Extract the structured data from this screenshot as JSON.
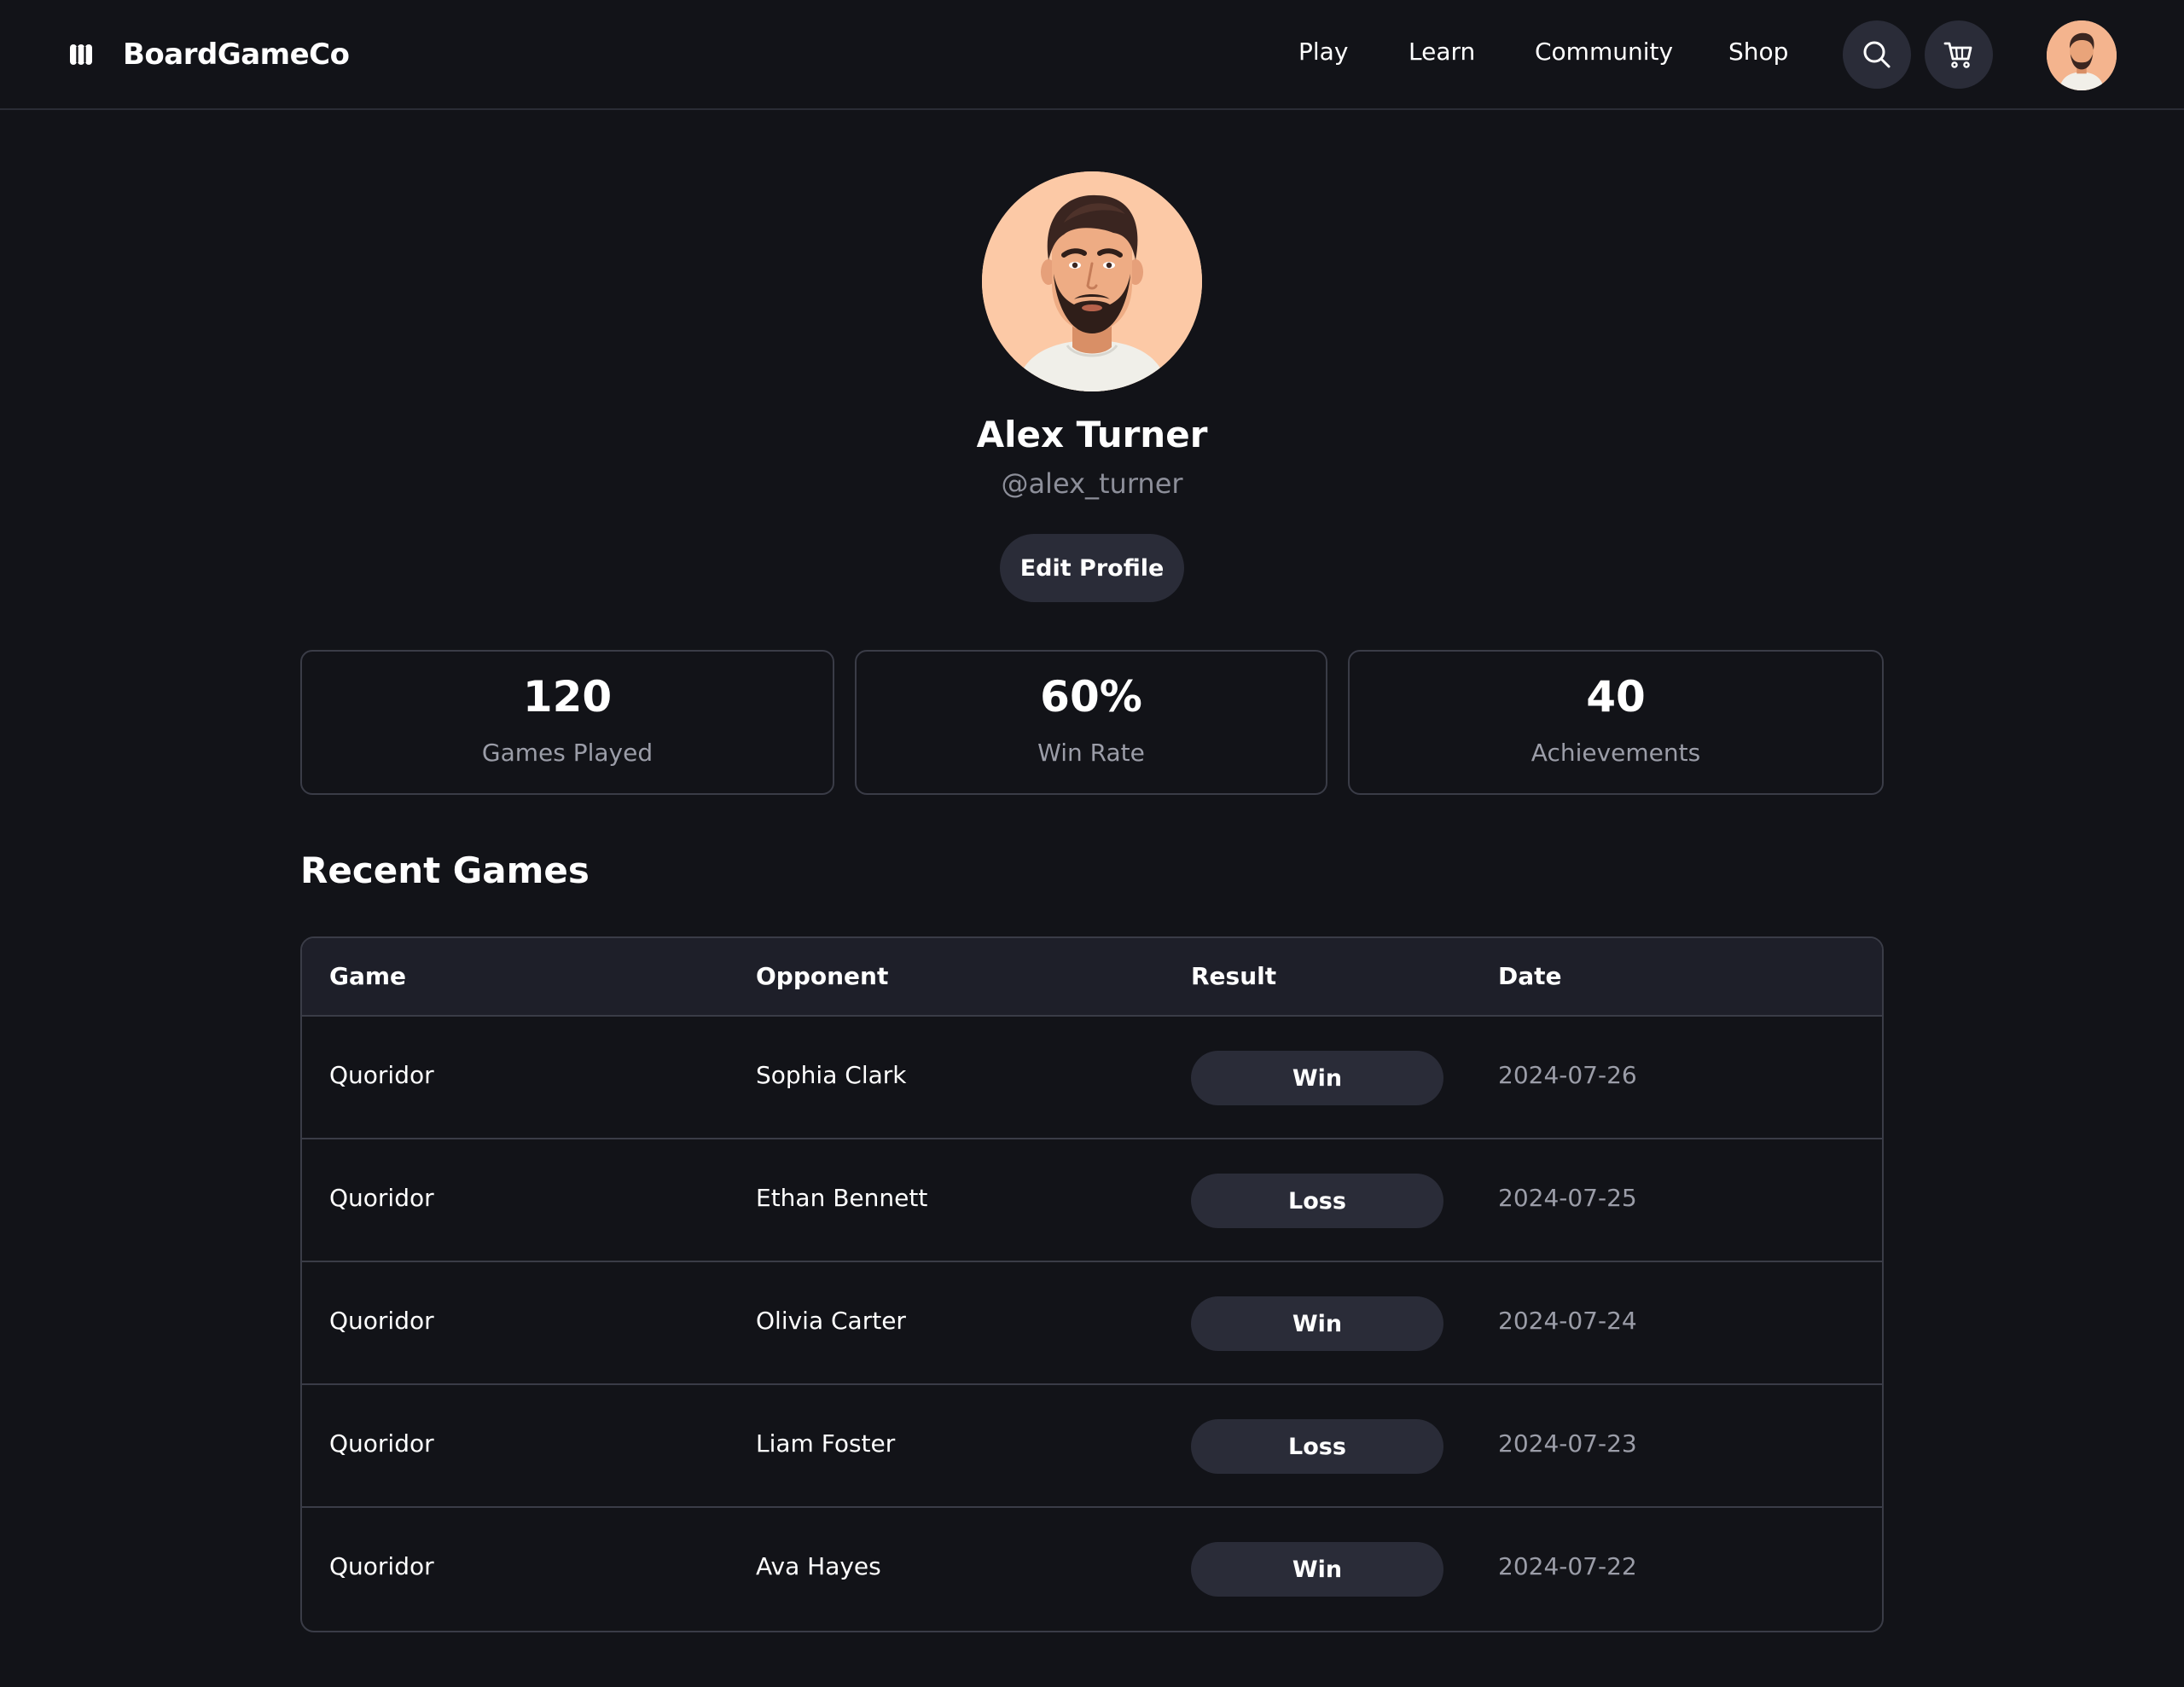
{
  "header": {
    "brand": "BoardGameCo",
    "nav": [
      "Play",
      "Learn",
      "Community",
      "Shop"
    ],
    "search_icon": "search-icon",
    "cart_icon": "cart-icon",
    "avatar_icon": "user-avatar"
  },
  "profile": {
    "name": "Alex Turner",
    "handle": "@alex_turner",
    "edit_label": "Edit Profile"
  },
  "stats": [
    {
      "value": "120",
      "label": "Games Played"
    },
    {
      "value": "60%",
      "label": "Win Rate"
    },
    {
      "value": "40",
      "label": "Achievements"
    }
  ],
  "recent": {
    "title": "Recent Games",
    "columns": [
      "Game",
      "Opponent",
      "Result",
      "Date"
    ],
    "rows": [
      {
        "game": "Quoridor",
        "opponent": "Sophia Clark",
        "result": "Win",
        "date": "2024-07-26"
      },
      {
        "game": "Quoridor",
        "opponent": "Ethan Bennett",
        "result": "Loss",
        "date": "2024-07-25"
      },
      {
        "game": "Quoridor",
        "opponent": "Olivia Carter",
        "result": "Win",
        "date": "2024-07-24"
      },
      {
        "game": "Quoridor",
        "opponent": "Liam Foster",
        "result": "Loss",
        "date": "2024-07-23"
      },
      {
        "game": "Quoridor",
        "opponent": "Ava Hayes",
        "result": "Win",
        "date": "2024-07-22"
      }
    ]
  },
  "colors": {
    "background": "#121318",
    "surface": "#1e1f29",
    "pill": "#2a2c38",
    "border": "#3a3c47",
    "muted_text": "#9b9da8",
    "avatar_bg": "#fcc9a6"
  }
}
